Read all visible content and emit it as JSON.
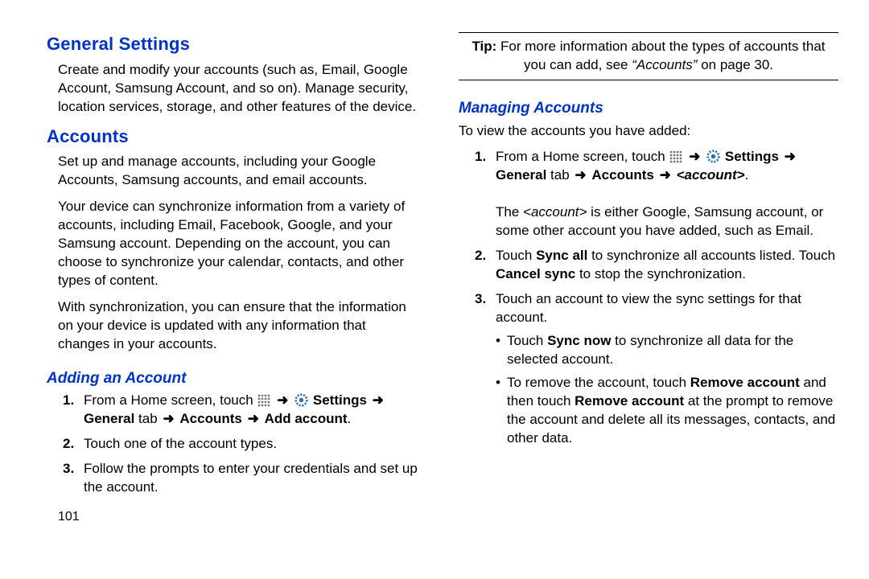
{
  "left": {
    "h_general": "General Settings",
    "p_general": "Create and modify your accounts (such as, Email, Google Account, Samsung Account, and so on). Manage security, location services, storage, and other features of the device.",
    "h_accounts": "Accounts",
    "p_acc1": "Set up and manage accounts, including your Google Accounts, Samsung accounts, and email accounts.",
    "p_acc2": "Your device can synchronize information from a variety of accounts, including Email, Facebook, Google, and your Samsung account. Depending on the account, you can choose to synchronize your calendar, contacts, and other types of content.",
    "p_acc3": "With synchronization, you can ensure that the information on your device is updated with any information that changes in your accounts.",
    "h_adding": "Adding an Account",
    "step1_pre": "From a Home screen, touch ",
    "settings_lbl": "Settings",
    "step1_line2a": "General",
    "step1_line2b": " tab ",
    "step1_line2c": "Accounts",
    "step1_line2d": "Add account",
    "period": ".",
    "step2": "Touch one of the account types.",
    "step3": "Follow the prompts to enter your credentials and set up the account.",
    "pagenum": "101"
  },
  "right": {
    "tip_pre": "Tip:",
    "tip_body": " For more information about the types of accounts that you can add, see ",
    "tip_ref": "“Accounts”",
    "tip_post": " on page 30.",
    "h_managing": "Managing Accounts",
    "p_intro": "To view the accounts you have added:",
    "m1_pre": "From a Home screen, touch ",
    "m1_settings": "Settings",
    "m1_general": "General",
    "m1_tab": " tab ",
    "m1_accounts": "Accounts",
    "m1_acct_var": "<account>",
    "m1_period": ".",
    "m1_p2a": "The ",
    "m1_p2b": "<account>",
    "m1_p2c": " is either Google, Samsung account, or some other account you have added, such as Email.",
    "m2a": "Touch ",
    "m2b": "Sync all",
    "m2c": " to synchronize all accounts listed. Touch ",
    "m2d": "Cancel sync",
    "m2e": " to stop the synchronization.",
    "m3": "Touch an account to view the sync settings for that account.",
    "b1a": "Touch ",
    "b1b": "Sync now",
    "b1c": " to synchronize all data for the selected account.",
    "b2a": "To remove the account, touch ",
    "b2b": "Remove account",
    "b2c": " and then touch ",
    "b2d": "Remove account",
    "b2e": " at the prompt to remove the account and delete all its messages, contacts, and other data."
  },
  "nums": {
    "n1": "1.",
    "n2": "2.",
    "n3": "3."
  },
  "arrow": "➜"
}
